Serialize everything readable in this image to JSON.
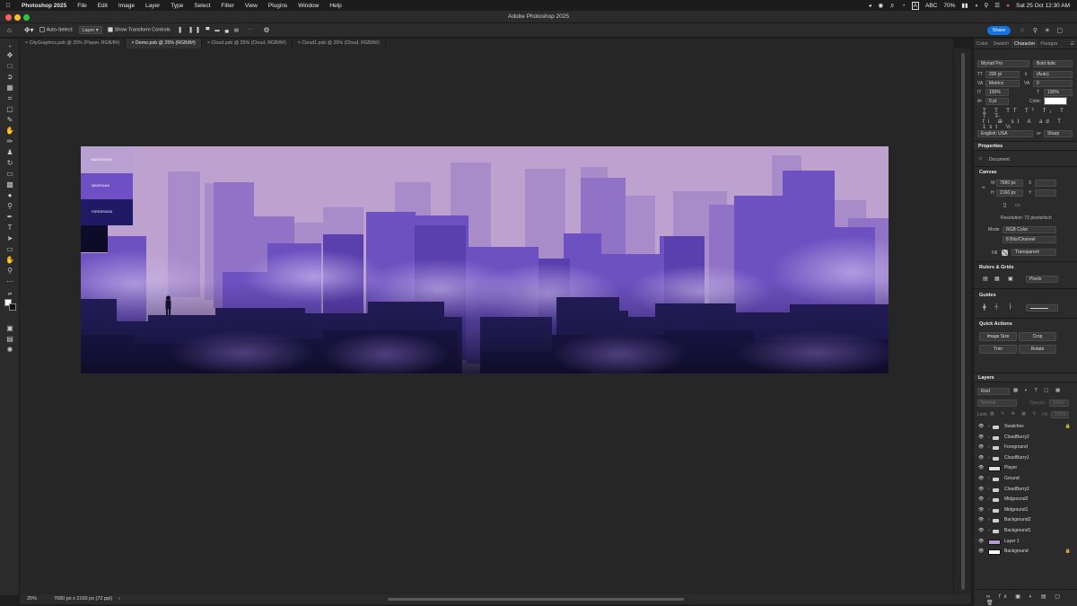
{
  "menubar": {
    "app": "Photoshop 2025",
    "items": [
      "File",
      "Edit",
      "Image",
      "Layer",
      "Type",
      "Select",
      "Filter",
      "View",
      "Plugins",
      "Window",
      "Help"
    ],
    "status": {
      "input_source": "A",
      "input_label": "ABC",
      "battery": "70%",
      "datetime": "Sat 25 Oct  12:30 AM"
    }
  },
  "window": {
    "title": "Adobe Photoshop 2025"
  },
  "options": {
    "auto_select_label": "Auto-Select:",
    "auto_select_value": "Layer",
    "show_transform_label": "Show Transform Controls",
    "share_label": "Share"
  },
  "tabs": [
    {
      "label": "CityGraphics.psb @ 25% (Player, RGB/8#)"
    },
    {
      "label": "Demo.psb @ 25% (RGB/8#)"
    },
    {
      "label": "Cloud.psb @ 25% (Cloud, RGB/8#)"
    },
    {
      "label": "Cloud1.psb @ 25% (Cloud, RGB/8#)"
    }
  ],
  "document": {
    "legend": [
      "BACKGROUND",
      "MIDGROUND",
      "FOREGROUND"
    ],
    "colors": {
      "sky": "#bda1cf",
      "far": "#a48ac6",
      "mid": "#6e52c0",
      "near": "#3c2d8c",
      "dark": "#18163a",
      "cloud": "#9f86cf"
    }
  },
  "status": {
    "zoom": "25%",
    "doc_info": "7680 px x 2160 px (72 ppi)"
  },
  "panel": {
    "tabs": [
      "Color",
      "Swatch",
      "Character",
      "Paragra"
    ],
    "character": {
      "font_family": "Myriad Pro",
      "font_style": "Bold Italic",
      "size": "200 pt",
      "leading": "(Auto)",
      "kerning": "Metrics",
      "tracking": "0",
      "vscale": "100%",
      "hscale": "100%",
      "baseline": "0 pt",
      "color_label": "Color:",
      "language": "English: USA",
      "antialias": "Sharp"
    },
    "properties": {
      "title": "Properties",
      "doc_label": "Document",
      "canvas_head": "Canvas",
      "w_label": "W",
      "w": "7680 px",
      "h_label": "H",
      "h": "2160 px",
      "x_label": "X",
      "y_label": "Y",
      "resolution": "Resolution: 72 pixels/inch",
      "mode_label": "Mode",
      "mode": "RGB Color",
      "depth": "8 Bits/Channel",
      "fill_label": "Fill",
      "fill": "Transparent",
      "rulers_head": "Rulers & Grids",
      "units": "Pixels",
      "guides_head": "Guides",
      "quick_head": "Quick Actions",
      "quick_actions": [
        "Image Size",
        "Crop",
        "Trim",
        "Rotate"
      ]
    },
    "layers": {
      "title": "Layers",
      "kind": "Kind",
      "blend": "Normal",
      "opacity_label": "Opacity:",
      "opacity": "100%",
      "lock_label": "Lock:",
      "fill_label": "Fill:",
      "fill": "100%",
      "items": [
        {
          "name": "Swatches",
          "type": "group",
          "lock": true
        },
        {
          "name": "CloudBurry2",
          "type": "group",
          "lock": false
        },
        {
          "name": "Foreground",
          "type": "group",
          "lock": false
        },
        {
          "name": "CloudBurry1",
          "type": "group",
          "lock": false
        },
        {
          "name": "Player",
          "type": "layer",
          "lock": false
        },
        {
          "name": "Ground",
          "type": "group",
          "lock": false
        },
        {
          "name": "CloudBurry2",
          "type": "group",
          "lock": false
        },
        {
          "name": "Midground2",
          "type": "group",
          "lock": false
        },
        {
          "name": "Midground1",
          "type": "group",
          "lock": false
        },
        {
          "name": "Background2",
          "type": "group",
          "lock": false
        },
        {
          "name": "Background1",
          "type": "group",
          "lock": false
        },
        {
          "name": "Layer 1",
          "type": "fill",
          "lock": false
        },
        {
          "name": "Background",
          "type": "white",
          "lock": true
        }
      ]
    }
  }
}
